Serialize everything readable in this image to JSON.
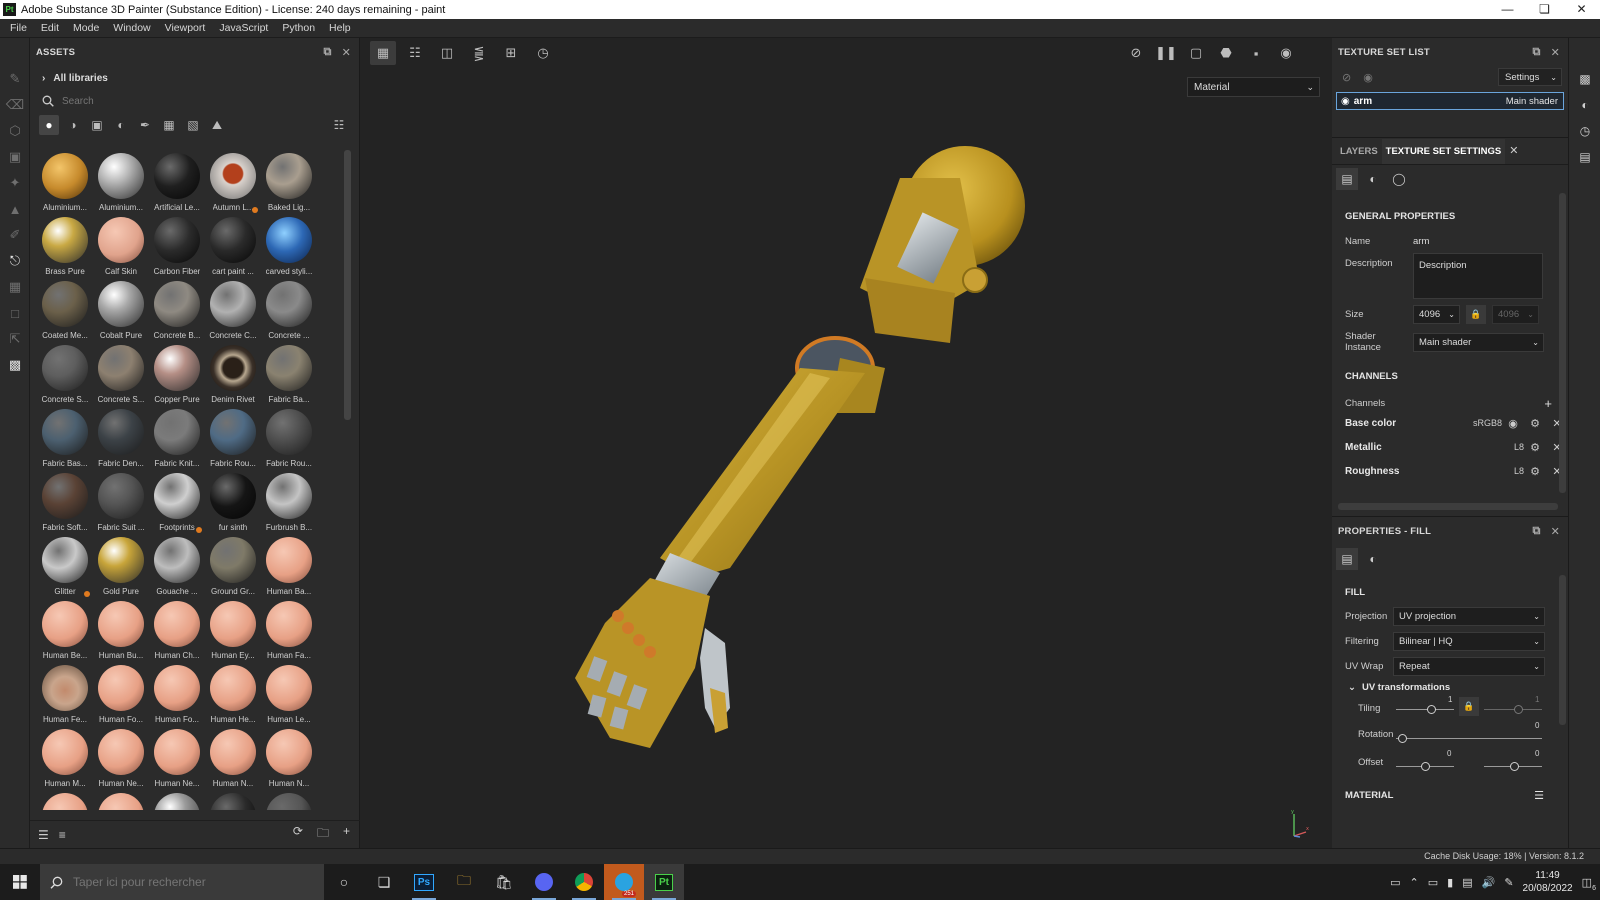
{
  "window": {
    "title": "Adobe Substance 3D Painter (Substance Edition) - License: 240 days remaining - paint",
    "app_badge": "Pt"
  },
  "menu": [
    "File",
    "Edit",
    "Mode",
    "Window",
    "Viewport",
    "JavaScript",
    "Python",
    "Help"
  ],
  "assets": {
    "title": "ASSETS",
    "library": "All libraries",
    "search_placeholder": "Search",
    "materials": [
      {
        "name": "Aluminium...",
        "color": "#c68a2c",
        "style": "gold-rough",
        "dot": false
      },
      {
        "name": "Aluminium...",
        "color": "#b7b7b7",
        "style": "metal",
        "dot": false
      },
      {
        "name": "Artificial Le...",
        "color": "#1f1f1f",
        "style": "dark",
        "dot": false
      },
      {
        "name": "Autumn L...",
        "color": "#d9d2cc",
        "style": "leaf",
        "dot": true
      },
      {
        "name": "Baked Lig...",
        "color": "#a99e8f",
        "style": "matte",
        "dot": false
      },
      {
        "name": "Brass Pure",
        "color": "#c9a944",
        "style": "metal",
        "dot": false
      },
      {
        "name": "Calf Skin",
        "color": "#e0a38c",
        "style": "skin",
        "dot": false
      },
      {
        "name": "Carbon Fiber",
        "color": "#2b2b2b",
        "style": "dark",
        "dot": false
      },
      {
        "name": "cart paint ...",
        "color": "#2a2a2a",
        "style": "dark",
        "dot": false
      },
      {
        "name": "carved styli...",
        "color": "#2d68b5",
        "style": "blue",
        "dot": false
      },
      {
        "name": "Coated Me...",
        "color": "#6b604a",
        "style": "matte",
        "dot": false
      },
      {
        "name": "Cobalt Pure",
        "color": "#a9a9a9",
        "style": "metal",
        "dot": false
      },
      {
        "name": "Concrete B...",
        "color": "#8f8a82",
        "style": "matte",
        "dot": false
      },
      {
        "name": "Concrete C...",
        "color": "#b1b1b1",
        "style": "matte",
        "dot": false
      },
      {
        "name": "Concrete ...",
        "color": "#8a8a8a",
        "style": "matte",
        "dot": false
      },
      {
        "name": "Concrete S...",
        "color": "#5e5e5e",
        "style": "matte",
        "dot": false
      },
      {
        "name": "Concrete S...",
        "color": "#8d8070",
        "style": "matte",
        "dot": false
      },
      {
        "name": "Copper Pure",
        "color": "#b58f86",
        "style": "metal",
        "dot": false
      },
      {
        "name": "Denim Rivet",
        "color": "#3a3028",
        "style": "rivet",
        "dot": false
      },
      {
        "name": "Fabric Ba...",
        "color": "#8a8270",
        "style": "matte",
        "dot": false
      },
      {
        "name": "Fabric Bas...",
        "color": "#4c6070",
        "style": "matte",
        "dot": false
      },
      {
        "name": "Fabric Den...",
        "color": "#3c4247",
        "style": "matte",
        "dot": false
      },
      {
        "name": "Fabric Knit...",
        "color": "#7b7b7b",
        "style": "matte",
        "dot": false
      },
      {
        "name": "Fabric Rou...",
        "color": "#4f6b85",
        "style": "matte",
        "dot": false
      },
      {
        "name": "Fabric Rou...",
        "color": "#505050",
        "style": "matte",
        "dot": false
      },
      {
        "name": "Fabric Soft...",
        "color": "#5a4235",
        "style": "matte",
        "dot": false
      },
      {
        "name": "Fabric Suit ...",
        "color": "#555555",
        "style": "matte",
        "dot": false
      },
      {
        "name": "Footprints",
        "color": "#cfcfcf",
        "style": "matte",
        "dot": true
      },
      {
        "name": "fur sinth",
        "color": "#151515",
        "style": "dark",
        "dot": false
      },
      {
        "name": "Furbrush B...",
        "color": "#c4c4c4",
        "style": "matte",
        "dot": false
      },
      {
        "name": "Glitter",
        "color": "#c9c9c9",
        "style": "matte",
        "dot": true
      },
      {
        "name": "Gold Pure",
        "color": "#c8a53a",
        "style": "metal",
        "dot": false
      },
      {
        "name": "Gouache ...",
        "color": "#bdbdbd",
        "style": "matte",
        "dot": false
      },
      {
        "name": "Ground Gr...",
        "color": "#7f7a68",
        "style": "matte",
        "dot": false
      },
      {
        "name": "Human Ba...",
        "color": "#e7a085",
        "style": "skin",
        "dot": false
      },
      {
        "name": "Human Be...",
        "color": "#e7a085",
        "style": "skin",
        "dot": false
      },
      {
        "name": "Human Bu...",
        "color": "#e7a085",
        "style": "skin",
        "dot": false
      },
      {
        "name": "Human Ch...",
        "color": "#e7a085",
        "style": "skin",
        "dot": false
      },
      {
        "name": "Human Ey...",
        "color": "#e7a085",
        "style": "skin",
        "dot": false
      },
      {
        "name": "Human Fa...",
        "color": "#e7a085",
        "style": "skin",
        "dot": false
      },
      {
        "name": "Human Fe...",
        "color": "#c9a58c",
        "style": "face",
        "dot": false
      },
      {
        "name": "Human Fo...",
        "color": "#e7a085",
        "style": "skin",
        "dot": false
      },
      {
        "name": "Human Fo...",
        "color": "#e7a085",
        "style": "skin",
        "dot": false
      },
      {
        "name": "Human He...",
        "color": "#e7a085",
        "style": "skin",
        "dot": false
      },
      {
        "name": "Human Le...",
        "color": "#e7a085",
        "style": "skin",
        "dot": false
      },
      {
        "name": "Human M...",
        "color": "#e7a085",
        "style": "skin",
        "dot": false
      },
      {
        "name": "Human Ne...",
        "color": "#e7a085",
        "style": "skin",
        "dot": false
      },
      {
        "name": "Human Ne...",
        "color": "#e7a085",
        "style": "skin",
        "dot": false
      },
      {
        "name": "Human N...",
        "color": "#e7a085",
        "style": "skin",
        "dot": false
      },
      {
        "name": "Human N...",
        "color": "#e7a085",
        "style": "skin",
        "dot": false
      },
      {
        "name": "",
        "color": "#e7a085",
        "style": "skin",
        "dot": false
      },
      {
        "name": "",
        "color": "#e7a085",
        "style": "skin",
        "dot": false
      },
      {
        "name": "",
        "color": "#9a9a9a",
        "style": "metal",
        "dot": false
      },
      {
        "name": "",
        "color": "#2a2a2a",
        "style": "dark",
        "dot": false
      },
      {
        "name": "",
        "color": "#555555",
        "style": "dark",
        "dot": false
      }
    ]
  },
  "viewport": {
    "mode_select": "Material",
    "axis_x": "x",
    "axis_y": "y"
  },
  "texture_set_list": {
    "title": "TEXTURE SET LIST",
    "settings_label": "Settings",
    "set_name": "arm",
    "set_shader": "Main shader"
  },
  "texture_set_settings": {
    "tab_layers": "LAYERS",
    "tab_settings": "TEXTURE SET SETTINGS",
    "general_title": "GENERAL PROPERTIES",
    "name_label": "Name",
    "name_value": "arm",
    "description_label": "Description",
    "description_value": "Description",
    "size_label": "Size",
    "size_value": "4096",
    "size_value_locked": "4096",
    "shader_instance_label": "Shader Instance",
    "shader_instance_value": "Main shader",
    "channels_title": "CHANNELS",
    "channels_label": "Channels",
    "channels": [
      {
        "name": "Base color",
        "format": "sRGB8"
      },
      {
        "name": "Metallic",
        "format": "L8"
      },
      {
        "name": "Roughness",
        "format": "L8"
      }
    ]
  },
  "properties_fill": {
    "title": "PROPERTIES - FILL",
    "fill_title": "FILL",
    "projection_label": "Projection",
    "projection_value": "UV projection",
    "filtering_label": "Filtering",
    "filtering_value": "Bilinear | HQ",
    "uvwrap_label": "UV Wrap",
    "uvwrap_value": "Repeat",
    "uv_transforms_title": "UV transformations",
    "tiling_label": "Tiling",
    "tiling_value": "1",
    "tiling_value2": "1",
    "rotation_label": "Rotation",
    "rotation_value": "0",
    "offset_label": "Offset",
    "offset_value": "0",
    "offset_value2": "0",
    "material_title": "MATERIAL"
  },
  "status": {
    "text": "Cache Disk Usage:   18% | Version: 8.1.2"
  },
  "taskbar": {
    "search_placeholder": "Taper ici pour rechercher",
    "time": "11:49",
    "date": "20/08/2022",
    "telegram_badge": "251",
    "notif_count": "6"
  }
}
